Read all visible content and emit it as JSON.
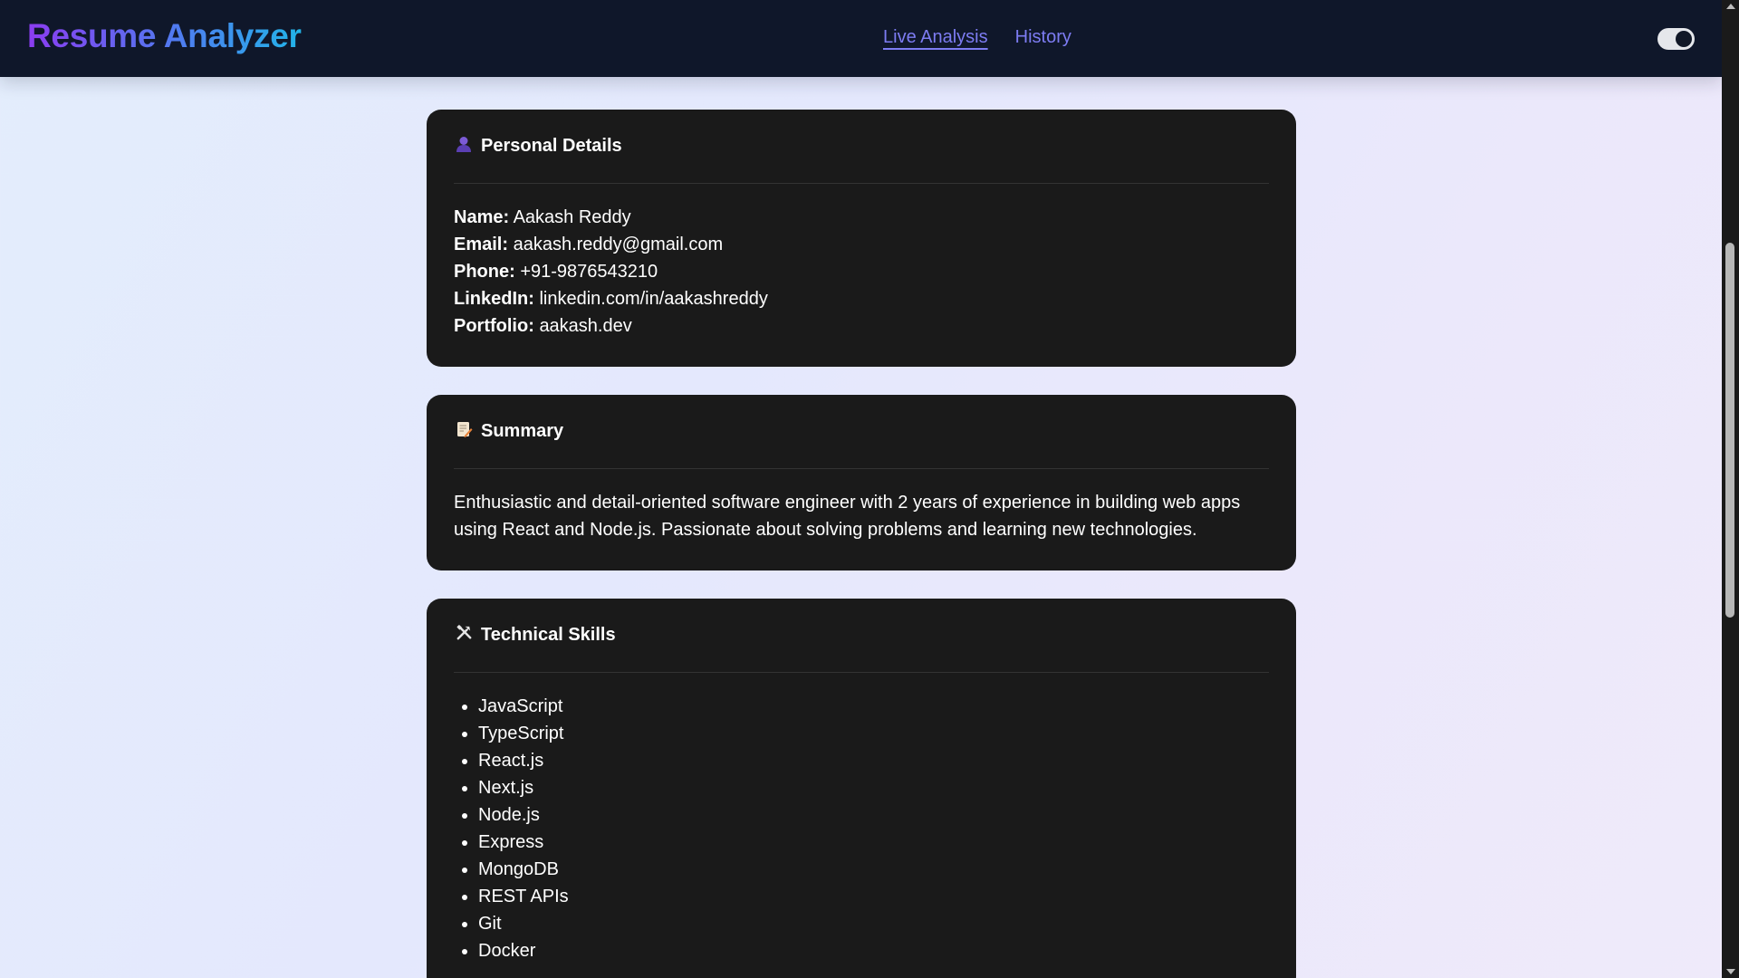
{
  "nav": {
    "brand": "Resume Analyzer",
    "links": [
      "Live Analysis",
      "History"
    ],
    "theme_toggle_state": "on"
  },
  "personal": {
    "icon": "person-icon",
    "title": "Personal Details",
    "fields": [
      {
        "label": "Name:",
        "value": "Aakash Reddy"
      },
      {
        "label": "Email:",
        "value": "aakash.reddy@gmail.com"
      },
      {
        "label": "Phone:",
        "value": "+91-9876543210"
      },
      {
        "label": "LinkedIn:",
        "value": "linkedin.com/in/aakashreddy"
      },
      {
        "label": "Portfolio:",
        "value": "aakash.dev"
      }
    ]
  },
  "summary": {
    "icon": "memo-icon",
    "title": "Summary",
    "text": "Enthusiastic and detail-oriented software engineer with 2 years of experience in building web apps using React and Node.js. Passionate about solving problems and learning new technologies."
  },
  "skills": {
    "icon": "tools-icon",
    "title": "Technical Skills",
    "items": [
      "JavaScript",
      "TypeScript",
      "React.js",
      "Next.js",
      "Node.js",
      "Express",
      "MongoDB",
      "REST APIs",
      "Git",
      "Docker"
    ]
  },
  "colors": {
    "navbar_bg": "#0f172a",
    "card_bg": "#1a1a1a",
    "nav_link": "#7d7cf2",
    "brand_gradient": [
      "#8b3cf0",
      "#4f7cf0",
      "#22b4e8"
    ]
  }
}
